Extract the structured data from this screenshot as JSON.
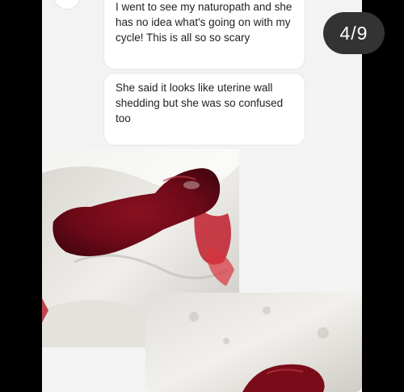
{
  "story": {
    "counter": "4/9",
    "messages": [
      {
        "text": "I went to see my naturopath and she has no idea what's going on with my cycle! This is all so so scary"
      },
      {
        "text": "She said it looks like uterine wall shedding but she was so confused too"
      }
    ],
    "photos": [
      {
        "icon": "tissue-photo"
      },
      {
        "icon": "tissue-photo"
      }
    ]
  },
  "colors": {
    "background": "#000000",
    "panel": "#f3f3f3",
    "bubble": "#ffffff",
    "counter_bg": "#333333"
  }
}
